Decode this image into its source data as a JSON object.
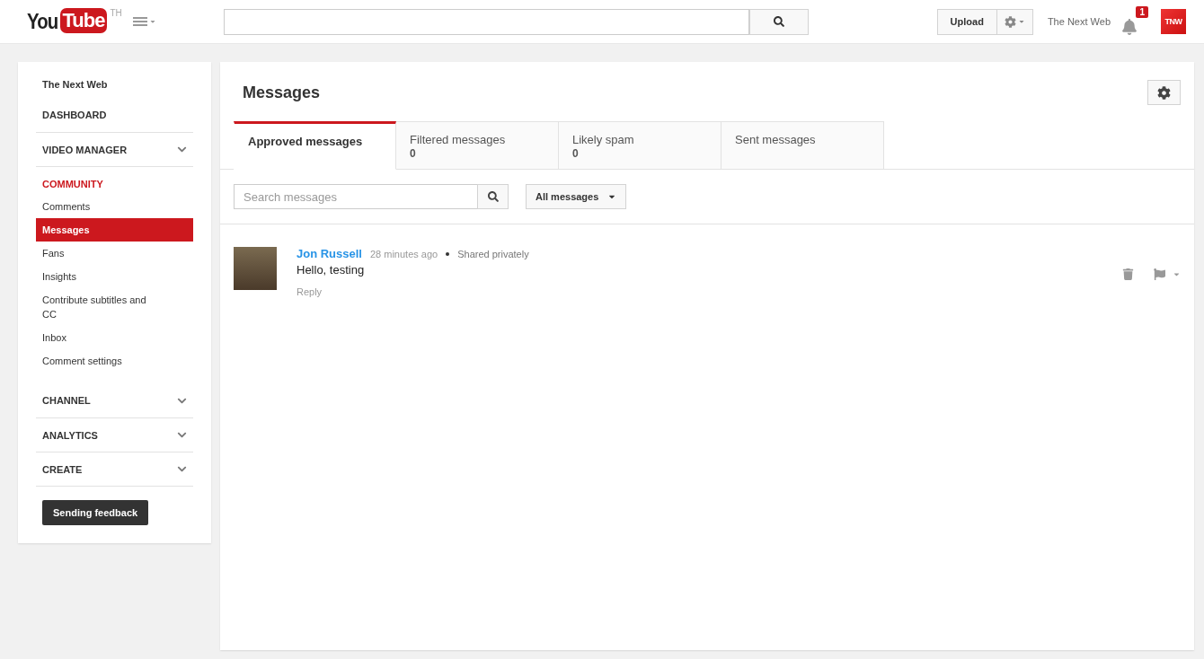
{
  "header": {
    "logo": {
      "you": "You",
      "tube": "Tube",
      "region": "TH"
    },
    "upload": "Upload",
    "account_name": "The Next Web",
    "notifications": "1",
    "avatar_text": "TNW"
  },
  "sidebar": {
    "items": [
      {
        "kind": "channel",
        "label": "The Next Web"
      },
      {
        "kind": "section",
        "label": "DASHBOARD",
        "expandable": false,
        "active": false
      },
      {
        "kind": "section",
        "label": "VIDEO MANAGER",
        "expandable": true,
        "active": false
      },
      {
        "kind": "section",
        "label": "COMMUNITY",
        "expandable": false,
        "active": true,
        "children": [
          {
            "label": "Comments",
            "selected": false
          },
          {
            "label": "Messages",
            "selected": true
          },
          {
            "label": "Fans",
            "selected": false
          },
          {
            "label": "Insights",
            "selected": false
          },
          {
            "label": "Contribute subtitles and CC",
            "selected": false
          },
          {
            "label": "Inbox",
            "selected": false
          },
          {
            "label": "Comment settings",
            "selected": false
          }
        ]
      },
      {
        "kind": "section",
        "label": "CHANNEL",
        "expandable": true,
        "active": false
      },
      {
        "kind": "section",
        "label": "ANALYTICS",
        "expandable": true,
        "active": false
      },
      {
        "kind": "section",
        "label": "CREATE",
        "expandable": true,
        "active": false
      }
    ],
    "feedback": "Sending feedback"
  },
  "main": {
    "title": "Messages",
    "tabs": [
      {
        "label": "Approved messages",
        "selected": true
      },
      {
        "label": "Filtered messages",
        "count": "0",
        "selected": false
      },
      {
        "label": "Likely spam",
        "count": "0",
        "selected": false
      },
      {
        "label": "Sent messages",
        "selected": false
      }
    ],
    "search": {
      "placeholder": "Search messages"
    },
    "filter": "All messages",
    "messages": [
      {
        "author": "Jon Russell",
        "time": "28 minutes ago",
        "visibility": "Shared privately",
        "text": "Hello, testing",
        "reply": "Reply"
      }
    ]
  }
}
